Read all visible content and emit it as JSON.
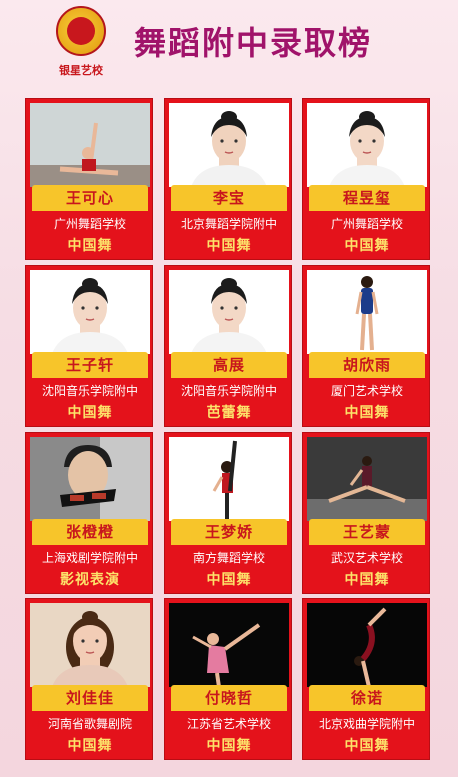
{
  "header": {
    "logo_text": "银星艺校",
    "title": "舞蹈附中录取榜"
  },
  "students": [
    {
      "name": "王可心",
      "school": "广州舞蹈学校",
      "major": "中国舞",
      "photo": "dancer-stretch-studio"
    },
    {
      "name": "李宝",
      "school": "北京舞蹈学院附中",
      "major": "中国舞",
      "photo": "boy-portrait"
    },
    {
      "name": "程昱玺",
      "school": "广州舞蹈学校",
      "major": "中国舞",
      "photo": "girl-portrait"
    },
    {
      "name": "王子轩",
      "school": "沈阳音乐学院附中",
      "major": "中国舞",
      "photo": "girl-portrait"
    },
    {
      "name": "高展",
      "school": "沈阳音乐学院附中",
      "major": "芭蕾舞",
      "photo": "girl-portrait"
    },
    {
      "name": "胡欣雨",
      "school": "厦门艺术学校",
      "major": "中国舞",
      "photo": "dancer-standing-leotard"
    },
    {
      "name": "张橙橙",
      "school": "上海戏剧学院附中",
      "major": "影视表演",
      "photo": "boy-with-glasses"
    },
    {
      "name": "王梦娇",
      "school": "南方舞蹈学校",
      "major": "中国舞",
      "photo": "dancer-leg-raise"
    },
    {
      "name": "王艺蒙",
      "school": "武汉艺术学校",
      "major": "中国舞",
      "photo": "dancer-split-stage"
    },
    {
      "name": "刘佳佳",
      "school": "河南省歌舞剧院",
      "major": "中国舞",
      "photo": "girl-portrait-smile"
    },
    {
      "name": "付晓哲",
      "school": "江苏省艺术学校",
      "major": "中国舞",
      "photo": "dancer-pink-dark"
    },
    {
      "name": "徐诺",
      "school": "北京戏曲学院附中",
      "major": "中国舞",
      "photo": "dancer-backbend-dark"
    }
  ],
  "colors": {
    "card_red": "#e4121b",
    "name_tab_yellow": "#f7c52a",
    "name_red": "#c8161d",
    "major_yellow": "#fde26a",
    "title_purple": "#a0136a"
  }
}
